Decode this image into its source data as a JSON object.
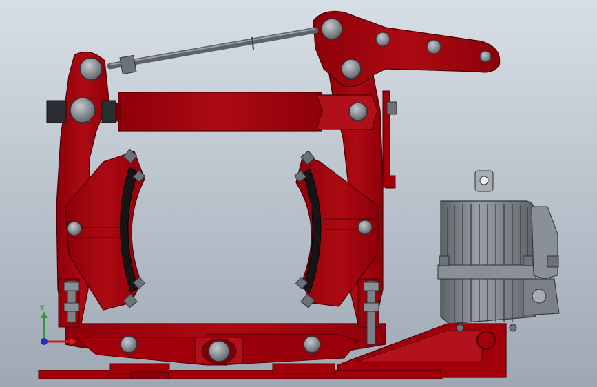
{
  "viewport": {
    "background_top": "#d7dee6",
    "background_bottom": "#9ea8b3"
  },
  "model": {
    "name": "brake-assembly",
    "colors": {
      "frame_red": "#a1000b",
      "frame_red_dark": "#6f0008",
      "frame_red_light": "#c21a22",
      "pin_gray": "#8a8f95",
      "pin_dark": "#4e5358",
      "rod_gray": "#6d7278",
      "motor_gray": "#7b8087",
      "motor_dark": "#4b5055",
      "lining_black": "#151515"
    }
  },
  "triad": {
    "y_label": "Y",
    "x_color": "#cc1f1f",
    "y_color": "#2e9c3a",
    "z_color": "#1b2fc4"
  }
}
